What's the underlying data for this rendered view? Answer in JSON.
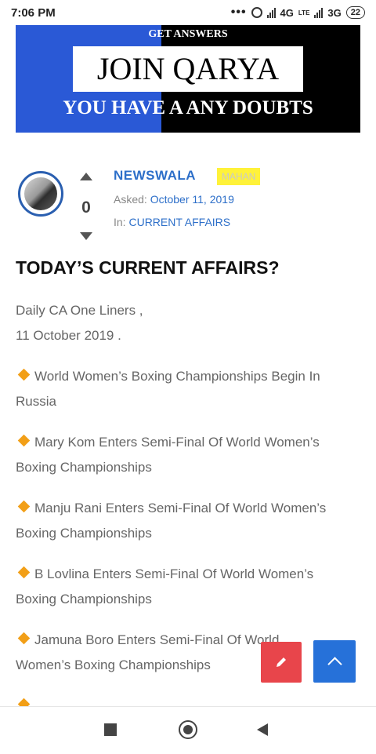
{
  "status_bar": {
    "time": "7:06 PM",
    "dots": "•••",
    "net1": "4G",
    "volte": "LTE",
    "net2": "3G",
    "battery": "22"
  },
  "banner": {
    "top": "GET ANSWERS",
    "headline": "JOIN QARYA",
    "bottom": "YOU HAVE A ANY DOUBTS"
  },
  "post": {
    "author": "NEWSWALA",
    "badge": "MAHAN",
    "votes": "0",
    "asked_label": "Asked:",
    "asked_date": "October 11, 2019",
    "in_label": "In:",
    "category": "CURRENT AFFAIRS",
    "title": "TODAY’S CURRENT AFFAIRS?",
    "intro_line1": "Daily CA One Liners ,",
    "intro_line2": "11 October 2019 .",
    "items": [
      {
        "line1": "World Women’s Boxing Championships Begin In",
        "line2": "Russia"
      },
      {
        "line1": "Mary Kom Enters Semi-Final Of World Women’s",
        "line2": "Boxing Championships"
      },
      {
        "line1": "Manju Rani Enters Semi-Final Of World Women’s",
        "line2": "Boxing Championships"
      },
      {
        "line1": "B Lovlina Enters Semi-Final Of World Women’s",
        "line2": "Boxing Championships"
      },
      {
        "line1": "Jamuna Boro Enters Semi-Final Of World",
        "line2": "Women’s Boxing Championships"
      }
    ]
  },
  "icons": {
    "edit": "pencil-icon",
    "scroll_top": "chevron-up-icon",
    "nav_recent": "square-icon",
    "nav_home": "circle-icon",
    "nav_back": "triangle-back-icon"
  },
  "colors": {
    "link": "#2d6fc9",
    "banner_blue": "#2a59d6",
    "bullet": "#f29f17",
    "edit_fab": "#e8454b",
    "up_fab": "#2671d9",
    "badge": "#fff23a"
  }
}
